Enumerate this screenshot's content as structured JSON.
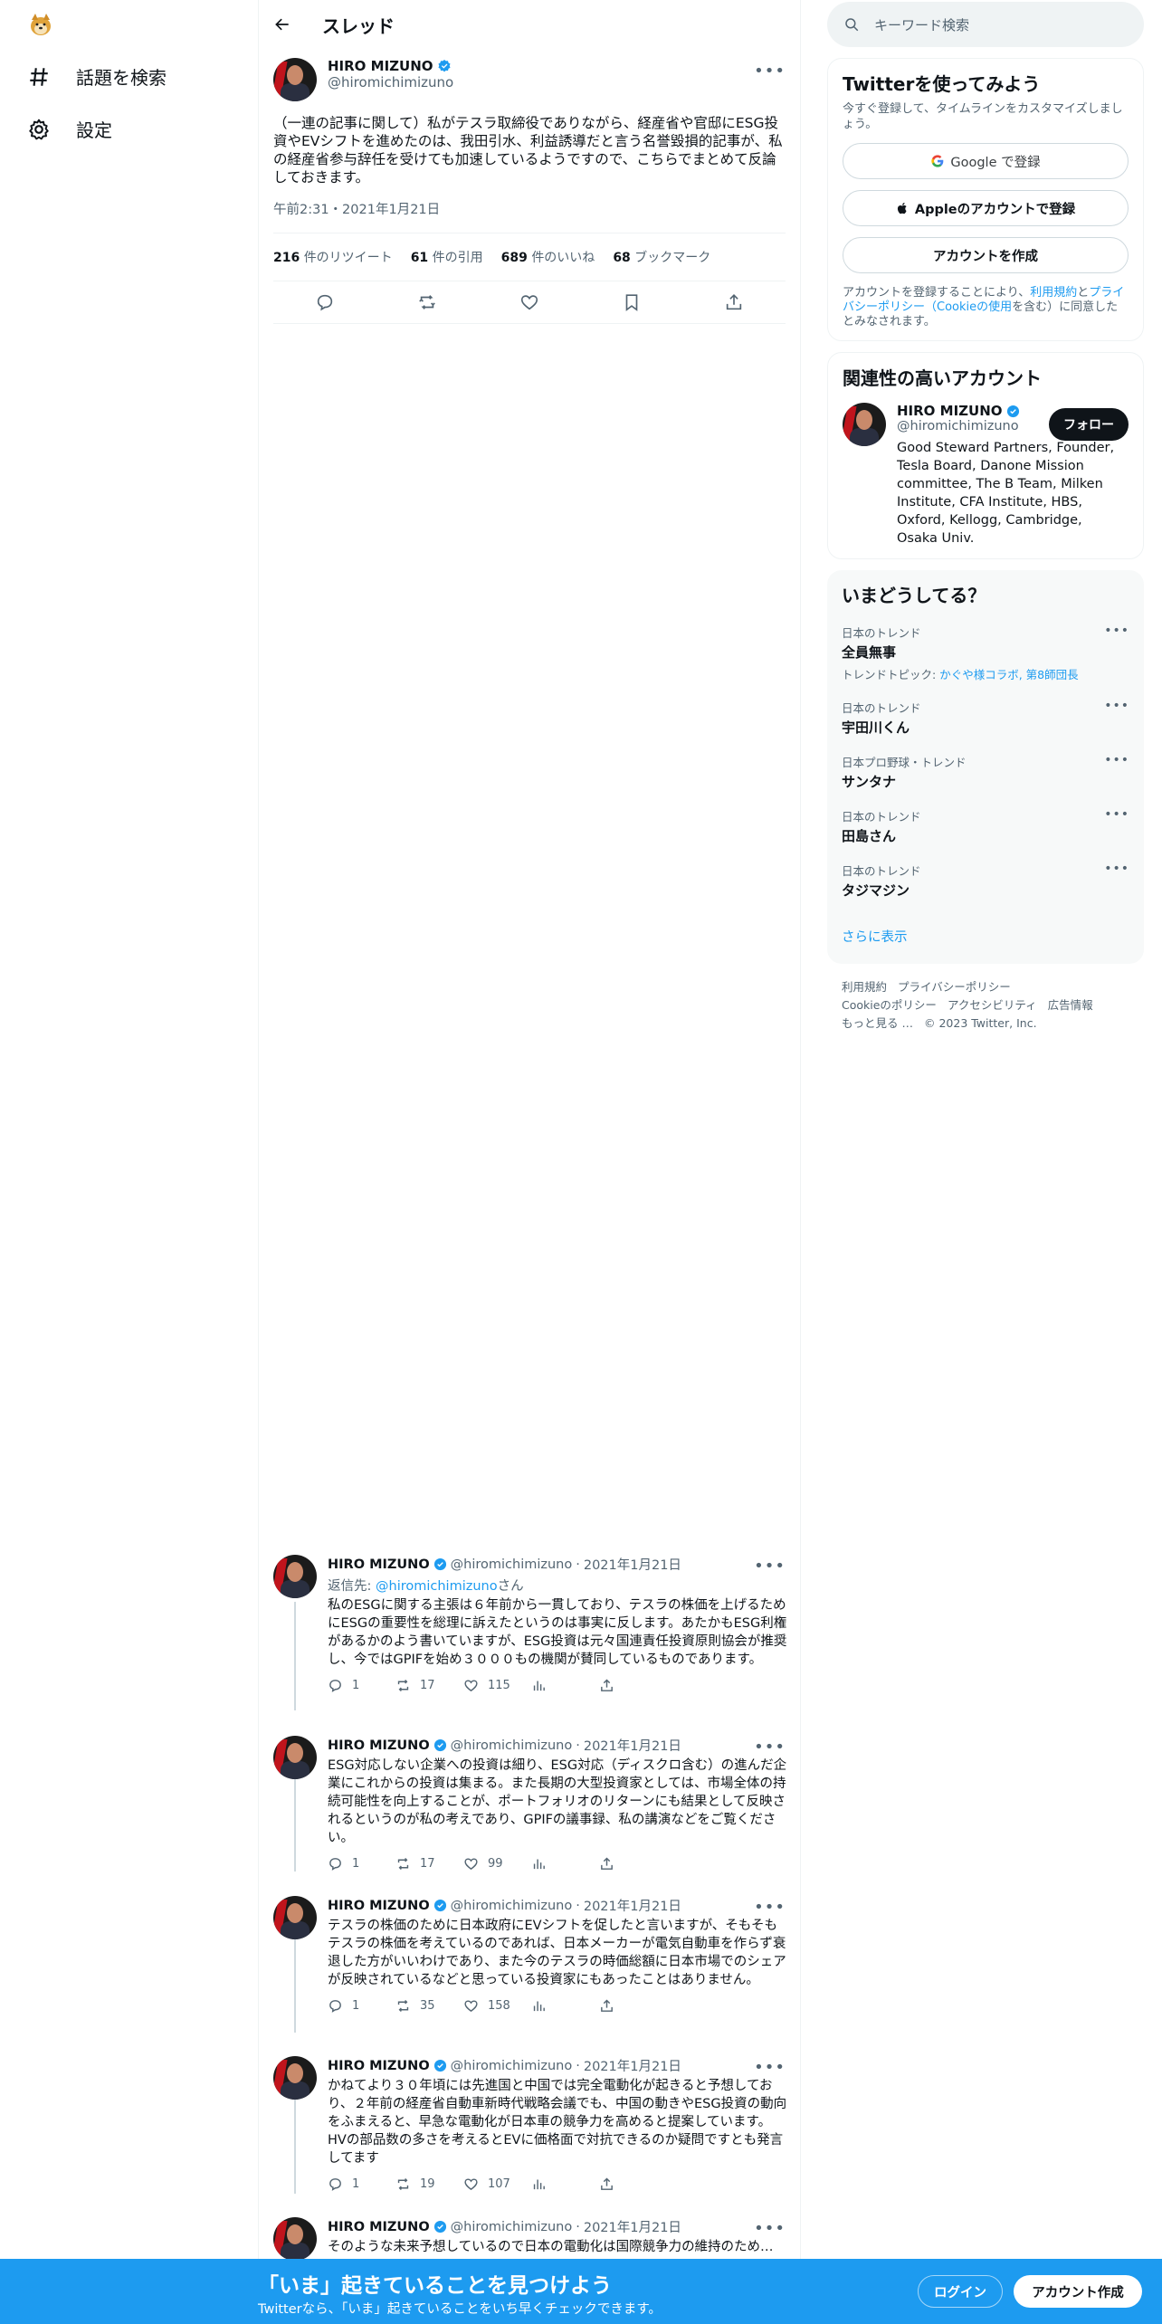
{
  "nav": {
    "explore_label": "話題を検索",
    "settings_label": "設定"
  },
  "thread": {
    "title": "スレッド",
    "author_name": "HIRO MIZUNO",
    "author_handle": "@hiromichimizuno",
    "text": "（一連の記事に関して）私がテスラ取締役でありながら、経産省や官邸にESG投資やEVシフトを進めたのは、我田引水、利益誘導だと言う名誉毀損的記事が、私の経産省参与辞任を受けても加速しているようですので、こちらでまとめて反論しておきます。",
    "timestamp": "午前2:31・2021年1月21日",
    "stats": {
      "retweets": "216",
      "retweets_label": "件のリツイート",
      "quotes": "61",
      "quotes_label": "件の引用",
      "likes": "689",
      "likes_label": "件のいいね",
      "bookmarks": "68",
      "bookmarks_label": "ブックマーク"
    }
  },
  "replies": [
    {
      "name": "HIRO MIZUNO",
      "handle": "@hiromichimizuno",
      "date": "2021年1月21日",
      "reply_to_prefix": "返信先: ",
      "reply_to_handle": "@hiromichimizuno",
      "reply_to_suffix": "さん",
      "text": "私のESGに関する主張は６年前から一貫しており、テスラの株価を上げるためにESGの重要性を総理に訴えたというのは事実に反します。あたかもESG利権があるかのよう書いていますが、ESG投資は元々国連責任投資原則協会が推奨し、今ではGPIFを始め３０００もの機関が賛同しているものであります。",
      "replies": "1",
      "retweets": "17",
      "likes": "115"
    },
    {
      "name": "HIRO MIZUNO",
      "handle": "@hiromichimizuno",
      "date": "2021年1月21日",
      "text": "ESG対応しない企業への投資は細り、ESG対応（ディスクロ含む）の進んだ企業にこれからの投資は集まる。また長期の大型投資家としては、市場全体の持続可能性を向上することが、ポートフォリオのリターンにも結果として反映されるというのが私の考えであり、GPIFの議事録、私の講演などをご覧ください。",
      "replies": "1",
      "retweets": "17",
      "likes": "99"
    },
    {
      "name": "HIRO MIZUNO",
      "handle": "@hiromichimizuno",
      "date": "2021年1月21日",
      "text": "テスラの株価のために日本政府にEVシフトを促したと言いますが、そもそもテスラの株価を考えているのであれば、日本メーカーが電気自動車を作らず衰退した方がいいわけであり、また今のテスラの時価総額に日本市場でのシェアが反映されているなどと思っている投資家にもあったことはありません。",
      "replies": "1",
      "retweets": "35",
      "likes": "158"
    },
    {
      "name": "HIRO MIZUNO",
      "handle": "@hiromichimizuno",
      "date": "2021年1月21日",
      "text": "かねてより３０年頃には先進国と中国では完全電動化が起きると予想しており、２年前の経産省自動車新時代戦略会議でも、中国の動きやESG投資の動向をふまえると、早急な電動化が日本車の競争力を高めると提案しています。HVの部品数の多さを考えるとEVに価格面で対抗できるのか疑問ですとも発言してます",
      "replies": "1",
      "retweets": "19",
      "likes": "107"
    },
    {
      "name": "HIRO MIZUNO",
      "handle": "@hiromichimizuno",
      "date": "2021年1月21日",
      "text": "そのような未来予想しているので日本の電動化は国際競争力の維持のため…"
    }
  ],
  "right": {
    "search_placeholder": "キーワード検索",
    "signup": {
      "title": "Twitterを使ってみよう",
      "subtitle": "今すぐ登録して、タイムラインをカスタマイズしましょう。",
      "google_label": "Google で登録",
      "apple_label": "Appleのアカウントで登録",
      "create_label": "アカウントを作成",
      "terms_prefix": "アカウントを登録することにより、",
      "terms_link": "利用規約",
      "terms_and": "と",
      "privacy_link": "プライバシーポリシー（Cookieの使用",
      "terms_suffix": "を含む）に同意したとみなされます。"
    },
    "related": {
      "title": "関連性の高いアカウント",
      "name": "HIRO MIZUNO",
      "handle": "@hiromichimizuno",
      "follow_label": "フォロー",
      "bio": "Good Steward Partners, Founder, Tesla Board, Danone Mission committee, The B Team, Milken Institute, CFA Institute, HBS, Oxford, Kellogg, Cambridge, Osaka Univ."
    },
    "trends": {
      "title": "いまどうしてる？",
      "items": [
        {
          "category": "日本のトレンド",
          "title": "全員無事",
          "topic_prefix": "トレンドトピック: ",
          "topic": "かぐや様コラボ, 第8師団長"
        },
        {
          "category": "日本のトレンド",
          "title": "宇田川くん"
        },
        {
          "category": "日本プロ野球・トレンド",
          "title": "サンタナ"
        },
        {
          "category": "日本のトレンド",
          "title": "田島さん"
        },
        {
          "category": "日本のトレンド",
          "title": "タジマジン"
        }
      ],
      "show_more": "さらに表示"
    },
    "footer": {
      "terms": "利用規約",
      "privacy": "プライバシーポリシー",
      "cookie": "Cookieのポリシー",
      "accessibility": "アクセシビリティ",
      "ads": "広告情報",
      "more": "もっと見る …",
      "copyright": "© 2023 Twitter, Inc."
    }
  },
  "banner": {
    "title": "「いま」起きていることを見つけよう",
    "subtitle": "Twitterなら、「いま」起きていることをいち早くチェックできます。",
    "login_label": "ログイン",
    "signup_label": "アカウント作成"
  },
  "colors": {
    "accent": "#1d9bf0",
    "text": "#0f1419",
    "muted": "#536471"
  }
}
